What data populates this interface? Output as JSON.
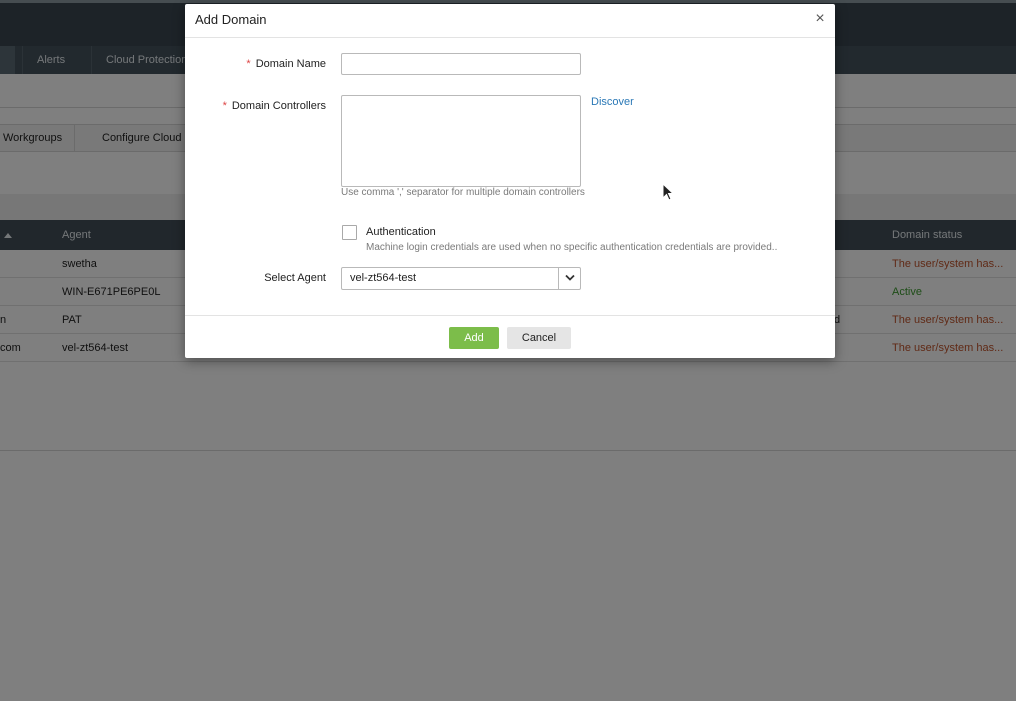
{
  "background": {
    "nav": {
      "alerts": "Alerts",
      "cloud_protection": "Cloud Protection"
    },
    "subtabs": {
      "workgroups": "Workgroups",
      "configure_cloud": "Configure Cloud"
    },
    "table": {
      "headers": {
        "agent": "Agent",
        "domain_status": "Domain status"
      },
      "rows": [
        {
          "left": "",
          "agent": "swetha",
          "extra": "",
          "status": "The user/system has..."
        },
        {
          "left": "",
          "agent": "WIN-E671PE6PE0L",
          "extra": "",
          "status": "Active"
        },
        {
          "left": "n",
          "agent": "PAT",
          "extra": "d",
          "status": "The user/system has..."
        },
        {
          "left": "com",
          "agent": "vel-zt564-test",
          "extra": "",
          "status": "The user/system has..."
        }
      ]
    }
  },
  "modal": {
    "title": "Add Domain",
    "close_symbol": "×",
    "required_mark": "*",
    "domain_name": {
      "label": "Domain Name",
      "value": ""
    },
    "domain_controllers": {
      "label": "Domain Controllers",
      "value": "",
      "hint": "Use comma ',' separator for multiple domain controllers",
      "discover_link": "Discover"
    },
    "authentication": {
      "label": "Authentication",
      "checked": false,
      "hint": "Machine login credentials are used when no specific authentication credentials are provided.."
    },
    "select_agent": {
      "label": "Select Agent",
      "value": "vel-zt564-test"
    },
    "buttons": {
      "add": "Add",
      "cancel": "Cancel"
    }
  },
  "colors": {
    "add_button": "#7cbd4a",
    "link": "#2a78b6",
    "status_error": "#c0552d",
    "status_active": "#3c9a2e",
    "header_dark": "#434f58"
  }
}
